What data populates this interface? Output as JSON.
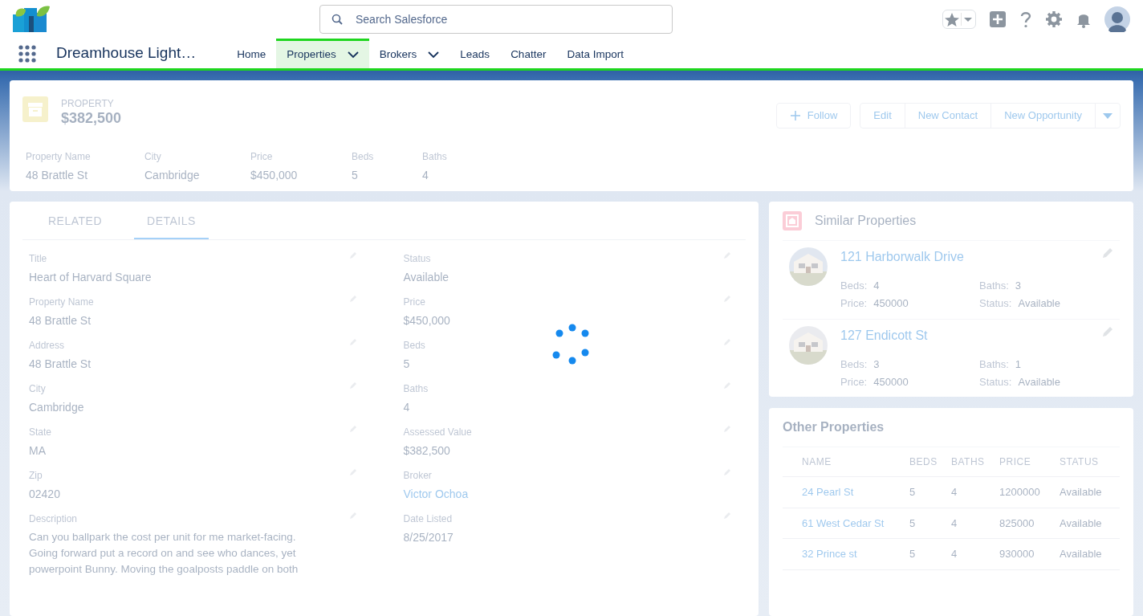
{
  "app": {
    "name": "Dreamhouse Light…"
  },
  "search": {
    "placeholder": "Search Salesforce"
  },
  "nav_items": [
    {
      "label": "Home",
      "selected": false,
      "has_menu": false
    },
    {
      "label": "Properties",
      "selected": true,
      "has_menu": true
    },
    {
      "label": "Brokers",
      "selected": false,
      "has_menu": true
    },
    {
      "label": "Leads",
      "selected": false,
      "has_menu": false
    },
    {
      "label": "Chatter",
      "selected": false,
      "has_menu": false
    },
    {
      "label": "Data Import",
      "selected": false,
      "has_menu": false
    }
  ],
  "loading": true,
  "record": {
    "type_label": "PROPERTY",
    "title": "$382,500",
    "actions": [
      {
        "label": "Follow",
        "kind": "follow"
      },
      {
        "label": "Edit",
        "kind": "group"
      },
      {
        "label": "New Contact",
        "kind": "group"
      },
      {
        "label": "New Opportunity",
        "kind": "group"
      }
    ],
    "highlights": [
      {
        "label": "Property Name",
        "value": "48 Brattle St"
      },
      {
        "label": "City",
        "value": "Cambridge"
      },
      {
        "label": "Price",
        "value": "$450,000"
      },
      {
        "label": "Beds",
        "value": "5"
      },
      {
        "label": "Baths",
        "value": "4"
      }
    ]
  },
  "tabs": [
    {
      "label": "RELATED",
      "selected": false
    },
    {
      "label": "DETAILS",
      "selected": true
    }
  ],
  "details": {
    "left": [
      {
        "label": "Title",
        "value": "Heart of Harvard Square",
        "kind": "text"
      },
      {
        "label": "Property Name",
        "value": "48 Brattle St",
        "kind": "text"
      },
      {
        "label": "Address",
        "value": "48 Brattle St",
        "kind": "text"
      },
      {
        "label": "City",
        "value": "Cambridge",
        "kind": "text"
      },
      {
        "label": "State",
        "value": "MA",
        "kind": "text"
      },
      {
        "label": "Zip",
        "value": "02420",
        "kind": "text"
      },
      {
        "label": "Description",
        "value": "Can you ballpark the cost per unit for me market-facing. Going forward put a record on and see who dances, yet powerpoint Bunny. Moving the goalposts paddle on both",
        "kind": "text"
      }
    ],
    "right": [
      {
        "label": "Status",
        "value": "Available",
        "kind": "text"
      },
      {
        "label": "Price",
        "value": "$450,000",
        "kind": "text"
      },
      {
        "label": "Beds",
        "value": "5",
        "kind": "text"
      },
      {
        "label": "Baths",
        "value": "4",
        "kind": "text"
      },
      {
        "label": "Assessed Value",
        "value": "$382,500",
        "kind": "text"
      },
      {
        "label": "Broker",
        "value": "Victor Ochoa",
        "kind": "link"
      },
      {
        "label": "Date Listed",
        "value": "8/25/2017",
        "kind": "text"
      }
    ]
  },
  "similar": {
    "title": "Similar Properties",
    "items": [
      {
        "name": "121 Harborwalk Drive",
        "fields": [
          {
            "label": "Beds:",
            "value": "4"
          },
          {
            "label": "Baths:",
            "value": "3"
          },
          {
            "label": "Price:",
            "value": "450000"
          },
          {
            "label": "Status:",
            "value": "Available"
          }
        ]
      },
      {
        "name": "127 Endicott St",
        "fields": [
          {
            "label": "Beds:",
            "value": "3"
          },
          {
            "label": "Baths:",
            "value": "1"
          },
          {
            "label": "Price:",
            "value": "450000"
          },
          {
            "label": "Status:",
            "value": "Available"
          }
        ]
      }
    ]
  },
  "other": {
    "title": "Other Properties",
    "columns": [
      "NAME",
      "BEDS",
      "BATHS",
      "PRICE",
      "STATUS"
    ],
    "rows": [
      [
        "24 Pearl St",
        "5",
        "4",
        "1200000",
        "Available"
      ],
      [
        "61 West Cedar St",
        "5",
        "4",
        "825000",
        "Available"
      ],
      [
        "32 Prince st",
        "5",
        "4",
        "930000",
        "Available"
      ]
    ]
  }
}
